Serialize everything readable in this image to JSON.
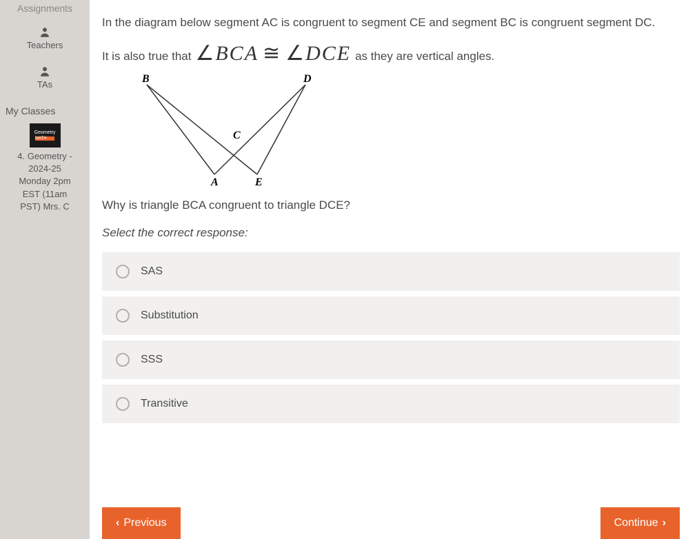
{
  "sidebar": {
    "assignments": "Assignments",
    "teachers": "Teachers",
    "tas": "TAs",
    "myClasses": "My Classes",
    "classThumb": {
      "line1": "Geometry",
      "badge": "MATH"
    },
    "classInfo": {
      "line1": "4. Geometry -",
      "line2": "2024-25",
      "line3": "Monday 2pm",
      "line4": "EST (11am",
      "line5": "PST) Mrs. C"
    }
  },
  "problem": {
    "intro": "In the diagram below segment AC is congruent to segment CE and segment BC is congruent segment DC.",
    "alsoTruePrefix": "It is also true that",
    "angle1": "BCA",
    "angle2": "DCE",
    "alsoTrueSuffix": "as they are vertical angles.",
    "question": "Why is triangle BCA congruent to triangle DCE?",
    "instruction": "Select the correct response:",
    "diagram": {
      "B": "B",
      "D": "D",
      "C": "C",
      "A": "A",
      "E": "E"
    },
    "options": [
      {
        "label": "SAS"
      },
      {
        "label": "Substitution"
      },
      {
        "label": "SSS"
      },
      {
        "label": "Transitive"
      }
    ]
  },
  "nav": {
    "previous": "Previous",
    "continue": "Continue"
  }
}
